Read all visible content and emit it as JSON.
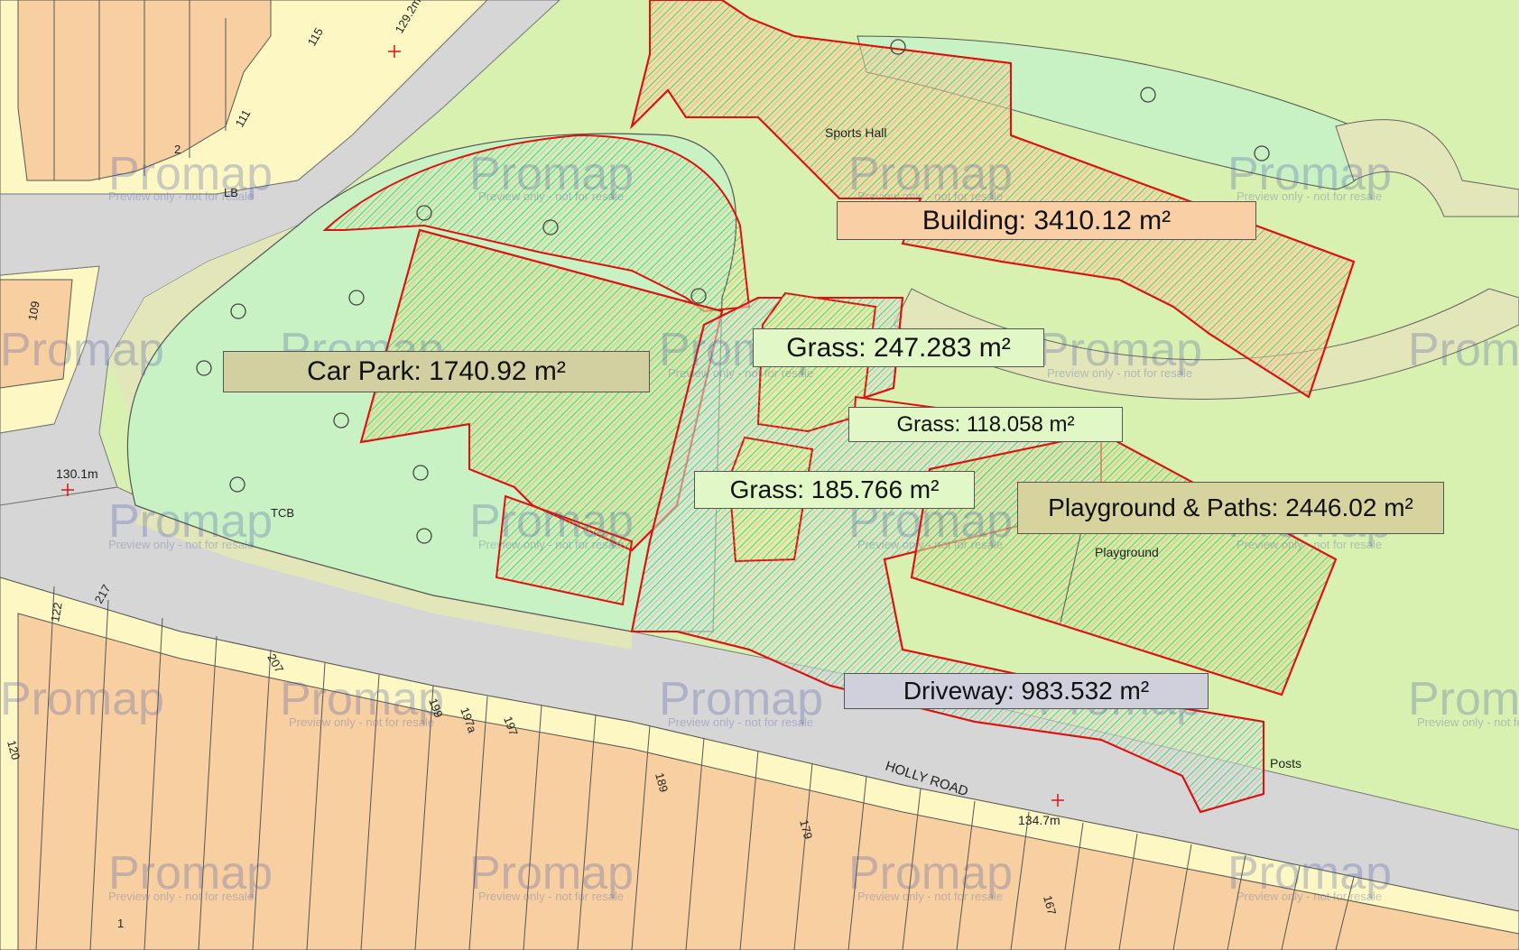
{
  "map": {
    "colors": {
      "residential_light": "#fdf7c4",
      "residential_orange": "#f7cfa1",
      "road": "#d6d6d6",
      "verge": "#e2e6b8",
      "grass_light": "#c9f2c4",
      "grass": "#d8f0b0",
      "outline": "#e01010",
      "hatch_green": "#5cbf4a"
    },
    "areas": [
      {
        "id": "building",
        "label": "Building: 3410.12 m²",
        "bg": "#f9d0a6"
      },
      {
        "id": "car-park",
        "label": "Car Park: 1740.92 m²",
        "bg": "#d2cfa0"
      },
      {
        "id": "grass-1",
        "label": "Grass: 247.283 m²",
        "bg": "#e2f7c6"
      },
      {
        "id": "grass-2",
        "label": "Grass: 118.058 m²",
        "bg": "#e2f7c6"
      },
      {
        "id": "grass-3",
        "label": "Grass: 185.766 m²",
        "bg": "#e2f7c6"
      },
      {
        "id": "playground",
        "label": "Playground & Paths: 2446.02 m²",
        "bg": "#d6d39e"
      },
      {
        "id": "driveway",
        "label": "Driveway: 983.532 m²",
        "bg": "#cfd0dc"
      }
    ],
    "place_labels": {
      "sports_hall": "Sports Hall",
      "playground": "Playground",
      "holly_road": "HOLLY ROAD",
      "posts": "Posts",
      "lb": "LB",
      "tcb": "TCB"
    },
    "spot_heights": [
      "129.2m",
      "130.1m",
      "134.7m"
    ],
    "house_numbers": [
      "115",
      "111",
      "2",
      "109",
      "122",
      "217",
      "207",
      "199",
      "197a",
      "197",
      "189",
      "179",
      "167",
      "120",
      "1"
    ],
    "watermark": {
      "brand": "Promap",
      "note": "Preview only - not for resale"
    }
  }
}
